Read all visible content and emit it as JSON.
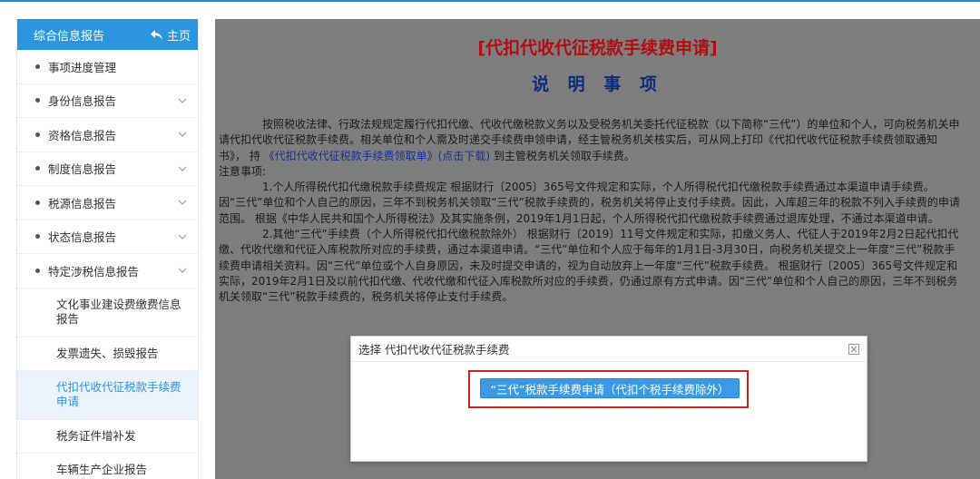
{
  "sidebar": {
    "title": "综合信息报告",
    "home_label": "主页",
    "items": [
      {
        "label": "事项进度管理",
        "has_chevron": false
      },
      {
        "label": "身份信息报告",
        "has_chevron": true
      },
      {
        "label": "资格信息报告",
        "has_chevron": true
      },
      {
        "label": "制度信息报告",
        "has_chevron": true
      },
      {
        "label": "税源信息报告",
        "has_chevron": true
      },
      {
        "label": "状态信息报告",
        "has_chevron": true
      },
      {
        "label": "特定涉税信息报告",
        "has_chevron": true
      }
    ],
    "subitems": [
      {
        "label": "文化事业建设费缴费信息报告",
        "active": false
      },
      {
        "label": "发票遗失、损毁报告",
        "active": false
      },
      {
        "label": "代扣代收代征税款手续费申请",
        "active": true
      },
      {
        "label": "税务证件增补发",
        "active": false
      },
      {
        "label": "车辆生产企业报告",
        "active": false
      }
    ]
  },
  "document": {
    "title": "[代扣代收代征税款手续费申请]",
    "subtitle": "说 明 事 项",
    "para1_a": "按照税收法律、行政法规规定履行代扣代缴、代收代缴税款义务以及受税务机关委托代征税款（以下简称“三代”）的单位和个人，可向税务机关申请代扣代收代征税款手续费。相关单位和个人需及时递交手续费申领申请，经主管税务机关核实后，可从网上打印《代扣代收代征税款手续费领取通知书》， 持 ",
    "para1_link": "《代扣代收代征税款手续费领取单》(点击下载)",
    "para1_b": " 到主管税务机关领取手续费。",
    "note_label": "注意事项:",
    "note1": "1.个人所得税代扣代缴税款手续费规定 根据财行〔2005〕365号文件规定和实际，个人所得税代扣代缴税款手续费通过本渠道申请手续费。 因“三代”单位和个人自己的原因，三年不到税务机关领取“三代”税款手续费的，税务机关将停止支付手续费。因此，入库超三年的税款不列入手续费的申请范围。 根据《中华人民共和国个人所得税法》及其实施条例，2019年1月1日起，个人所得税代扣代缴税款手续费通过退库处理，不通过本渠道申请。",
    "note2": "2.其他“三代”手续费（个人所得税代扣代缴税款除外） 根据财行〔2019〕11号文件规定和实际，扣缴义务人、代征人于2019年2月2日起代扣代缴、代收代缴和代征入库税款所对应的手续费，通过本渠道申请。“三代”单位和个人应于每年的1月1日-3月30日，向税务机关提交上一年度“三代”税款手续费申请相关资料。因“三代”单位或个人自身原因，未及时提交申请的，视为自动放弃上一年度“三代”税款手续费。 根据财行〔2005〕365号文件规定和实际，2019年2月1日及以前代扣代缴、代收代缴和代征入库税款所对应的手续费，仍通过原有方式申请。因“三代”单位和个人自己的原因，三年不到税务机关领取“三代”税款手续费的，税务机关将停止支付手续费。"
  },
  "modal": {
    "title": "选择 代扣代收代征税款手续费",
    "button_label": "“三代”税款手续费申请（代扣个税手续费除外）"
  },
  "colors": {
    "accent": "#2b95e0",
    "title_red": "#b20d12",
    "subtitle_blue": "#0c2d7e",
    "highlight_red": "#d62020"
  }
}
